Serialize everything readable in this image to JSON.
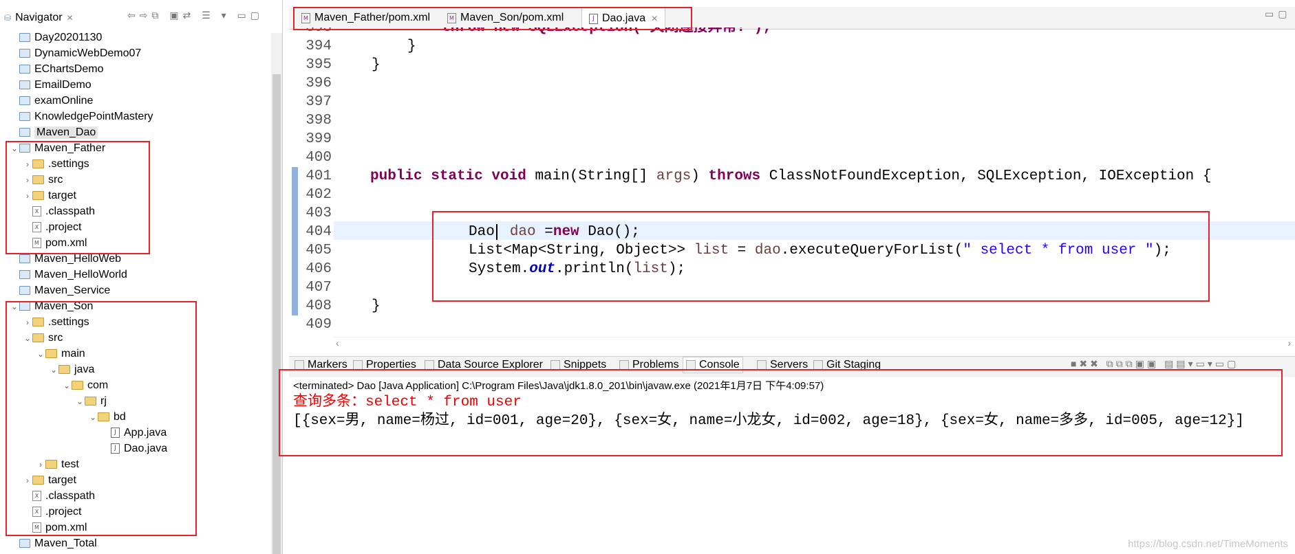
{
  "navigator": {
    "title": "Navigator",
    "items": [
      {
        "label": "Day20201130",
        "icon": "folder-icon",
        "depth": 0,
        "twisty": ""
      },
      {
        "label": "DynamicWebDemo07",
        "icon": "folder-icon",
        "depth": 0,
        "twisty": ""
      },
      {
        "label": "EChartsDemo",
        "icon": "folder-icon",
        "depth": 0,
        "twisty": ""
      },
      {
        "label": "EmailDemo",
        "icon": "folder-icon",
        "depth": 0,
        "twisty": ""
      },
      {
        "label": "examOnline",
        "icon": "folder-icon",
        "depth": 0,
        "twisty": ""
      },
      {
        "label": "KnowledgePointMastery",
        "icon": "folder-icon",
        "depth": 0,
        "twisty": ""
      },
      {
        "label": "Maven_Dao",
        "icon": "folder-icon",
        "depth": 0,
        "twisty": "",
        "selected": true
      },
      {
        "label": "Maven_Father",
        "icon": "project-icon",
        "depth": 0,
        "twisty": "v"
      },
      {
        "label": ".settings",
        "icon": "open-folder-icon",
        "depth": 1,
        "twisty": ">"
      },
      {
        "label": "src",
        "icon": "open-folder-icon",
        "depth": 1,
        "twisty": ">"
      },
      {
        "label": "target",
        "icon": "open-folder-icon",
        "depth": 1,
        "twisty": ">"
      },
      {
        "label": ".classpath",
        "icon": "xml-file-icon",
        "depth": 1,
        "twisty": ""
      },
      {
        "label": ".project",
        "icon": "xml-file-icon",
        "depth": 1,
        "twisty": ""
      },
      {
        "label": "pom.xml",
        "icon": "pom-file-icon",
        "depth": 1,
        "twisty": ""
      },
      {
        "label": "Maven_HelloWeb",
        "icon": "folder-icon",
        "depth": 0,
        "twisty": ""
      },
      {
        "label": "Maven_HelloWorld",
        "icon": "folder-icon",
        "depth": 0,
        "twisty": ""
      },
      {
        "label": "Maven_Service",
        "icon": "folder-icon",
        "depth": 0,
        "twisty": ""
      },
      {
        "label": "Maven_Son",
        "icon": "project-icon",
        "depth": 0,
        "twisty": "v"
      },
      {
        "label": ".settings",
        "icon": "open-folder-icon",
        "depth": 1,
        "twisty": ">"
      },
      {
        "label": "src",
        "icon": "open-folder-icon",
        "depth": 1,
        "twisty": "v"
      },
      {
        "label": "main",
        "icon": "open-folder-icon",
        "depth": 2,
        "twisty": "v"
      },
      {
        "label": "java",
        "icon": "open-folder-icon",
        "depth": 3,
        "twisty": "v"
      },
      {
        "label": "com",
        "icon": "open-folder-icon",
        "depth": 4,
        "twisty": "v"
      },
      {
        "label": "rj",
        "icon": "open-folder-icon",
        "depth": 5,
        "twisty": "v"
      },
      {
        "label": "bd",
        "icon": "open-folder-icon",
        "depth": 6,
        "twisty": "v"
      },
      {
        "label": "App.java",
        "icon": "java-file-icon",
        "depth": 7,
        "twisty": ""
      },
      {
        "label": "Dao.java",
        "icon": "java-file-icon",
        "depth": 7,
        "twisty": ""
      },
      {
        "label": "test",
        "icon": "open-folder-icon",
        "depth": 2,
        "twisty": ">"
      },
      {
        "label": "target",
        "icon": "open-folder-icon",
        "depth": 1,
        "twisty": ">"
      },
      {
        "label": ".classpath",
        "icon": "xml-file-icon",
        "depth": 1,
        "twisty": ""
      },
      {
        "label": ".project",
        "icon": "xml-file-icon",
        "depth": 1,
        "twisty": ""
      },
      {
        "label": "pom.xml",
        "icon": "pom-file-icon",
        "depth": 1,
        "twisty": ""
      },
      {
        "label": "Maven_Total",
        "icon": "folder-icon",
        "depth": 0,
        "twisty": ""
      }
    ]
  },
  "editor": {
    "tabs": [
      {
        "label": "Maven_Father/pom.xml",
        "icon": "pom-file-icon",
        "active": false
      },
      {
        "label": "Maven_Son/pom.xml",
        "icon": "pom-file-icon",
        "active": false
      },
      {
        "label": "Dao.java",
        "icon": "java-file-icon",
        "active": true
      }
    ],
    "line_numbers": [
      "394",
      "395",
      "396",
      "397",
      "398",
      "399",
      "400",
      "401",
      "402",
      "403",
      "404",
      "405",
      "406",
      "407",
      "408",
      "409"
    ],
    "code": {
      "l393": "throw new SQLException(\"关闭连接异常!\");",
      "l394": "}",
      "l395": "}",
      "l401_kw": "public static void",
      "l401_main": " main(String[] ",
      "l401_args": "args",
      "l401_paren": ") ",
      "l401_throws": "throws",
      "l401_rest": " ClassNotFoundException, SQLException, IOException {",
      "l404_type": "Dao",
      "l404_var": "dao",
      "l404_eq": " =",
      "l404_new": "new",
      "l404_rest": " Dao();",
      "l405_a": "List<Map<String, Object>> ",
      "l405_list": "list",
      "l405_b": " = ",
      "l405_dao": "dao",
      "l405_c": ".executeQueryForList(",
      "l405_str": "\" select * from user \"",
      "l405_d": ");",
      "l406_a": "System.",
      "l406_out": "out",
      "l406_b": ".println(",
      "l406_list": "list",
      "l406_c": ");",
      "l408": "}"
    }
  },
  "console": {
    "tabs": [
      "Markers",
      "Properties",
      "Data Source Explorer",
      "Snippets",
      "Problems",
      "Console",
      "Servers",
      "Git Staging"
    ],
    "active_tab": "Console",
    "terminated": "<terminated> Dao [Java Application] C:\\Program Files\\Java\\jdk1.8.0_201\\bin\\javaw.exe (2021年1月7日 下午4:09:57)",
    "output_line1": "查询多条：select * from user",
    "output_line2": "[{sex=男, name=杨过, id=001, age=20}, {sex=女, name=小龙女, id=002, age=18}, {sex=女, name=多多, id=005, age=12}]"
  },
  "watermark": "https://blog.csdn.net/TimeMoments",
  "colors": {
    "highlight": "#e8202a",
    "keyword": "#7f0055",
    "string": "#2a00ff",
    "console_red": "#e00000"
  }
}
